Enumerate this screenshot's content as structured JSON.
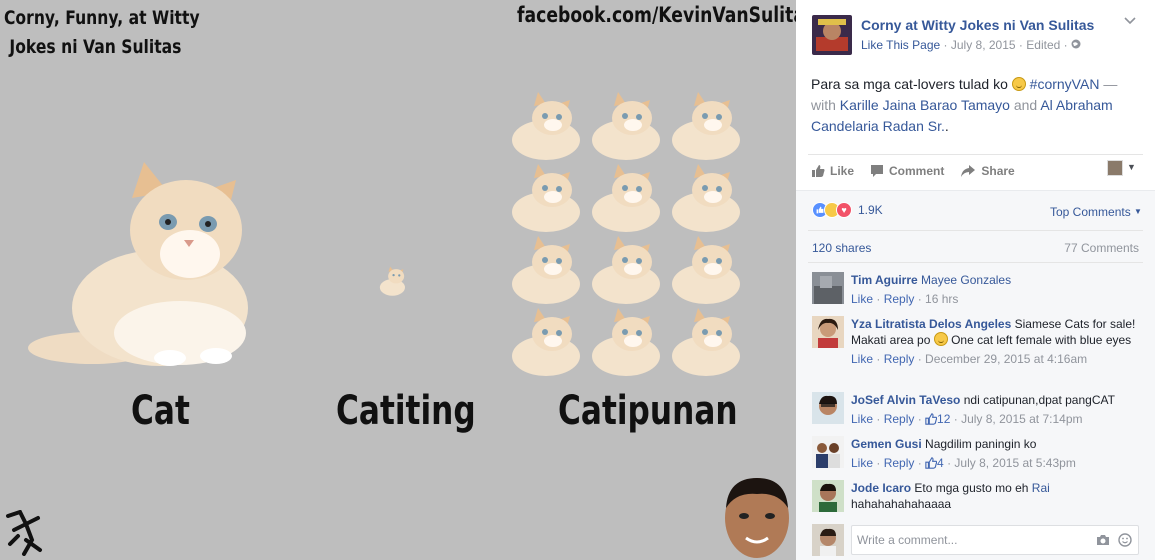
{
  "meme": {
    "title_line1": "Corny, Funny, at Witty",
    "title_line2": " Jokes ni Van Sulitas",
    "url": "facebook.com/KevinVanSulitas",
    "captions": [
      "Cat",
      "Catiting",
      "Catipunan"
    ]
  },
  "post": {
    "page_name": "Corny at Witty Jokes ni Van Sulitas",
    "like_page": "Like This Page",
    "date": "July 8, 2015",
    "edited": "Edited",
    "text_intro": "Para sa mga cat-lovers tulad ko ",
    "hashtag": "#cornyVAN",
    "with_dash": " — with ",
    "tag1": "Karille Jaina Barao Tamayo",
    "and_word": " and ",
    "tag2": "Al Abraham Candelaria Radan Sr.",
    "period": "."
  },
  "actions": {
    "like": "Like",
    "comment": "Comment",
    "share": "Share"
  },
  "stats": {
    "reactions": "1.9K",
    "top_comments": "Top Comments",
    "shares": "120 shares",
    "comments": "77 Comments"
  },
  "comments": [
    {
      "name": "Tim Aguirre",
      "tag": "Mayee Gonzales",
      "text": "",
      "like": "Like",
      "reply": "Reply",
      "likes": "",
      "time": "16 hrs"
    },
    {
      "name": "Yza Litratista Delos Angeles",
      "tag": "",
      "text": "Siamese Cats for sale! Makati area po",
      "text2": " One cat left female with blue eyes",
      "like": "Like",
      "reply": "Reply",
      "likes": "",
      "time": "December 29, 2015 at 4:16am"
    },
    {
      "name": "JoSef Alvin TaVeso",
      "tag": "",
      "text": "ndi catipunan,dpat pangCAT",
      "like": "Like",
      "reply": "Reply",
      "likes": "12",
      "time": "July 8, 2015 at 7:14pm"
    },
    {
      "name": "Gemen Gusi",
      "tag": "",
      "text": "Nagdilim paningin ko",
      "like": "Like",
      "reply": "Reply",
      "likes": "4",
      "time": "July 8, 2015 at 5:43pm"
    },
    {
      "name": "Jode Icaro",
      "tag": "Rai",
      "text": "Eto mga gusto mo eh",
      "text2": "hahahahahahaaaa",
      "like": "Like",
      "reply": "Reply",
      "likes": "",
      "time": ""
    }
  ],
  "composer": {
    "placeholder": "Write a comment..."
  },
  "colors": {
    "fb_link": "#365899",
    "muted": "#90949c",
    "photo_bg": "#bebebe"
  }
}
